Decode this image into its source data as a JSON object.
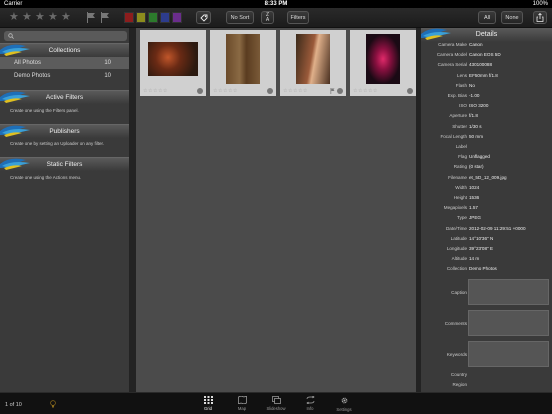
{
  "status_bar": {
    "carrier": "Carrier",
    "time": "8:33 PM",
    "battery": "100%"
  },
  "toolbar": {
    "rating_stars": 5,
    "color_labels": [
      "#8c1d1d",
      "#8c8c1d",
      "#2c7a2c",
      "#2d3c8c",
      "#6a2d8c"
    ],
    "no_sort_label": "No Sort",
    "filters_label": "Filters",
    "all_label": "All",
    "none_label": "None",
    "icons": [
      "star-icon",
      "flag-icon",
      "tag-icon",
      "sort-az-icon",
      "share-icon"
    ]
  },
  "left_panel": {
    "collections": {
      "title": "Collections",
      "items": [
        {
          "label": "All Photos",
          "count": "10"
        },
        {
          "label": "Demo Photos",
          "count": "10"
        }
      ]
    },
    "active_filters": {
      "title": "Active Filters",
      "hint": "Create one using the Filters panel."
    },
    "publishers": {
      "title": "Publishers",
      "hint": "Create one by setting an Uploader on any filter."
    },
    "static_filters": {
      "title": "Static Filters",
      "hint": "Create one using the Actions menu."
    }
  },
  "grid": {
    "thumbnails": [
      {
        "name": "mushrooms",
        "flagged": false
      },
      {
        "name": "wooden-door",
        "flagged": false
      },
      {
        "name": "tree-bark",
        "flagged": true
      },
      {
        "name": "red-doorway",
        "flagged": false
      }
    ]
  },
  "details": {
    "title": "Details",
    "rows": [
      {
        "k": "Camera Make",
        "v": "Canon"
      },
      {
        "k": "Camera Model",
        "v": "Canon EOS 5D"
      },
      {
        "k": "Camera Serial",
        "v": "430100088"
      },
      {
        "k": "Lens",
        "v": "EF50mm f/1.8"
      },
      {
        "k": "Flash",
        "v": "No"
      },
      {
        "k": "Exp. Bias",
        "v": "-1.00"
      },
      {
        "k": "ISO",
        "v": "ISO 3200"
      },
      {
        "k": "Aperture",
        "v": "f/1.8"
      },
      {
        "k": "Shutter",
        "v": "1/30 s"
      },
      {
        "k": "Focal Length",
        "v": "50 mm"
      },
      {
        "k": "Label",
        "v": ""
      },
      {
        "k": "Flag",
        "v": "Unflagged"
      },
      {
        "k": "Rating",
        "v": "(0 star)"
      },
      {
        "k": "Filename",
        "v": "et_5D_12_009.jpg"
      },
      {
        "k": "Width",
        "v": "1024"
      },
      {
        "k": "Height",
        "v": "1536"
      },
      {
        "k": "Megapixels",
        "v": "1.57"
      },
      {
        "k": "Type",
        "v": "JPEG"
      },
      {
        "k": "Date/Time",
        "v": "2012-02-09 11:29:51 +0000"
      },
      {
        "k": "Latitude",
        "v": "14°10'36\" N"
      },
      {
        "k": "Longitude",
        "v": "39°23'08\" E"
      },
      {
        "k": "Altitude",
        "v": "14 m"
      },
      {
        "k": "Collection",
        "v": "Demo Photos"
      }
    ],
    "text_fields": [
      "Caption",
      "Comments",
      "Keywords"
    ],
    "bottom_rows": [
      "Country",
      "Region",
      "City"
    ]
  },
  "tabbar": {
    "count": "1 of 10",
    "tabs": [
      {
        "label": "Grid",
        "icon": "grid-icon"
      },
      {
        "label": "Map",
        "icon": "map-icon"
      },
      {
        "label": "Slideshow",
        "icon": "slideshow-icon"
      },
      {
        "label": "Info",
        "icon": "info-icon"
      },
      {
        "label": "Settings",
        "icon": "gear-icon"
      }
    ]
  }
}
